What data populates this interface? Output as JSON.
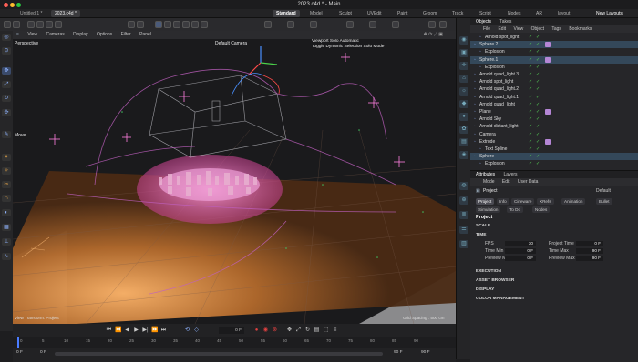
{
  "window": {
    "title": "2023.c4d * - Main"
  },
  "doc_tabs": [
    "Untitled 1 *",
    "2023.c4d *"
  ],
  "layouts": [
    "Standard",
    "Model",
    "Sculpt",
    "UVEdit",
    "Paint",
    "Groom",
    "Track",
    "Script",
    "Nodes",
    "AR",
    "layout"
  ],
  "active_layout": "Standard",
  "new_layouts_label": "New Layouts",
  "viewport": {
    "menu": [
      "View",
      "Cameras",
      "Display",
      "Options",
      "Filter",
      "Panel"
    ],
    "name": "Perspective",
    "camera": "Default Camera",
    "solo_line1": "Viewport Solo Automatic",
    "solo_line2": "Toggle Dynamic Selection Solo Mode",
    "tool": "Move",
    "transform": "View Transform: Project",
    "grid": "Grid Spacing : 500 cm"
  },
  "objects_panel": {
    "tabs": [
      "Objects",
      "Takes"
    ],
    "menu": [
      "File",
      "Edit",
      "View",
      "Object",
      "Tags",
      "Bookmarks"
    ],
    "items": [
      {
        "name": "Arnold spot_light",
        "indent": 1
      },
      {
        "name": "Sphere.2",
        "indent": 0
      },
      {
        "name": "Explosion",
        "indent": 1
      },
      {
        "name": "Sphere.1",
        "indent": 0
      },
      {
        "name": "Explosion",
        "indent": 1
      },
      {
        "name": "Arnold quad_light.3",
        "indent": 0
      },
      {
        "name": "Arnold spot_light",
        "indent": 0
      },
      {
        "name": "Arnold quad_light.2",
        "indent": 0
      },
      {
        "name": "Arnold quad_light.1",
        "indent": 0
      },
      {
        "name": "Arnold quad_light",
        "indent": 0
      },
      {
        "name": "Plane",
        "indent": 0
      },
      {
        "name": "Arnold Sky",
        "indent": 0
      },
      {
        "name": "Arnold distant_light",
        "indent": 0
      },
      {
        "name": "Camera",
        "indent": 0
      },
      {
        "name": "Extrude",
        "indent": 0
      },
      {
        "name": "Text Spline",
        "indent": 1
      },
      {
        "name": "Sphere",
        "indent": 0
      },
      {
        "name": "Explosion",
        "indent": 1
      }
    ]
  },
  "attributes": {
    "tabs": [
      "Attributes",
      "Layers"
    ],
    "menu": [
      "Mode",
      "Edit",
      "User Data"
    ],
    "title": "Project",
    "preset": "Default",
    "buttons_row1": [
      "Project",
      "Info",
      "Cineware",
      "XRefs",
      "Animation",
      "Bullet"
    ],
    "buttons_row2": [
      "Simulation",
      "To Do",
      "Nodes"
    ],
    "section": "Project",
    "groups": {
      "scale": "SCALE",
      "time": "TIME",
      "execution": "EXECUTION",
      "asset_browser": "ASSET BROWSER",
      "display": "DISPLAY",
      "color_management": "COLOR MANAGEMENT"
    },
    "fields": {
      "fps_label": "FPS",
      "fps": "30",
      "project_time_label": "Project Time",
      "project_time": "0 F",
      "time_min_label": "Time Min",
      "time_min": "0 F",
      "time_max_label": "Time Max",
      "time_max": "90 F",
      "preview_min_label": "Preview Min",
      "preview_min": "0 F",
      "preview_max_label": "Preview Max",
      "preview_max": "90 F"
    }
  },
  "timeline": {
    "current_frame": "0 F",
    "ticks": [
      "0",
      "5",
      "10",
      "15",
      "20",
      "25",
      "30",
      "35",
      "40",
      "45",
      "50",
      "55",
      "60",
      "65",
      "70",
      "75",
      "80",
      "85",
      "90"
    ],
    "start": "0 F",
    "start2": "0 F",
    "end": "90 F",
    "end2": "90 F"
  },
  "colors": {
    "accent": "#4a7cff",
    "selection": "#34485a",
    "check": "#55cc55",
    "tag": "#b586d6",
    "record": "#e04040"
  }
}
